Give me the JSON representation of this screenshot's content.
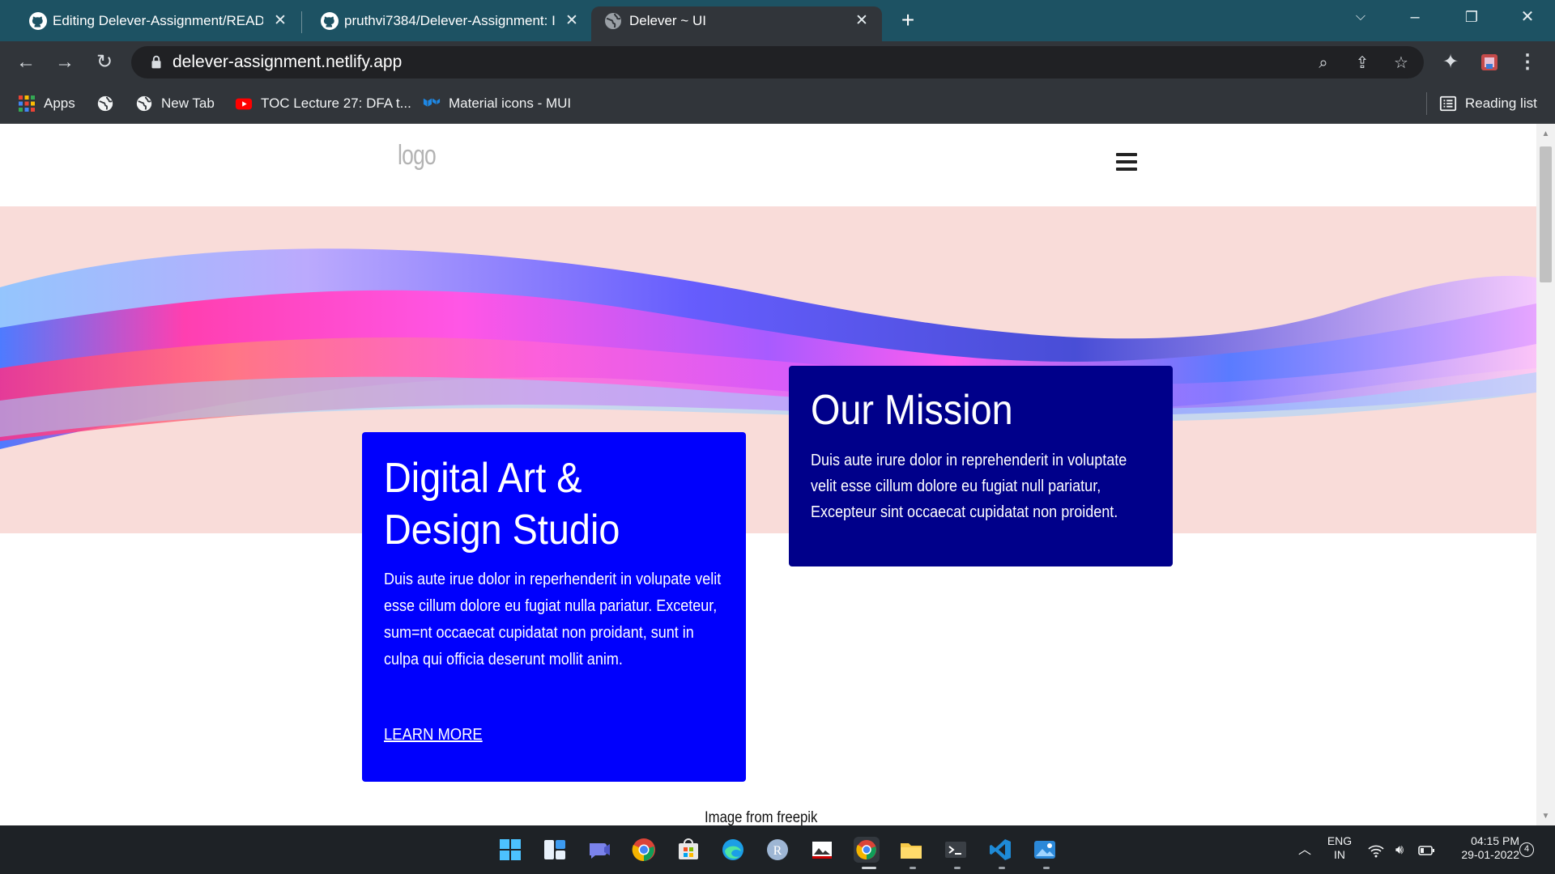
{
  "browser": {
    "tabs": [
      {
        "title": "Editing Delever-Assignment/READM",
        "icon": "github-icon",
        "active": false
      },
      {
        "title": "pruthvi7384/Delever-Assignment: I",
        "icon": "github-icon",
        "active": false
      },
      {
        "title": "Delever ~ UI",
        "icon": "globe-icon",
        "active": true
      }
    ],
    "url": "delever-assignment.netlify.app",
    "bookmarks": [
      {
        "label": "Apps",
        "icon": "apps-grid-icon"
      },
      {
        "label": "",
        "icon": "globe-icon"
      },
      {
        "label": "New Tab",
        "icon": "globe-icon"
      },
      {
        "label": "TOC Lecture 27: DFA t...",
        "icon": "youtube-icon"
      },
      {
        "label": "Material icons - MUI",
        "icon": "mui-icon"
      }
    ],
    "reading_list_label": "Reading list"
  },
  "site": {
    "logo_text": "logo",
    "studio_card": {
      "title": "Digital Art & Design Studio",
      "body": "Duis aute irue dolor in reperhenderit in volupate velit esse cillum dolore eu fugiat nulla pariatur. Exceteur, sum=nt occaecat cupidatat non proidant, sunt in culpa qui officia deserunt mollit anim.",
      "link_label": "LEARN MORE"
    },
    "mission_card": {
      "title": "Our Mission",
      "body": "Duis aute irure dolor in reprehenderit in voluptate velit esse cillum dolore eu fugiat null pariatur, Excepteur sint occaecat cupidatat non proident."
    },
    "image_credit": "Image from freepik",
    "colors": {
      "hero_bg": "#f9dcd9",
      "studio_card": "#0000fd",
      "mission_card": "#00008a"
    }
  },
  "taskbar": {
    "apps": [
      "windows-start-icon",
      "widgets-icon",
      "teams-chat-icon",
      "chrome-icon",
      "store-icon",
      "edge-icon",
      "r-app-icon",
      "paint-icon",
      "chrome-dev-icon",
      "file-explorer-icon",
      "terminal-icon",
      "vscode-icon",
      "photos-icon"
    ],
    "language": "ENG",
    "region": "IN",
    "time": "04:15 PM",
    "date": "29-01-2022",
    "notification_count": "4"
  }
}
